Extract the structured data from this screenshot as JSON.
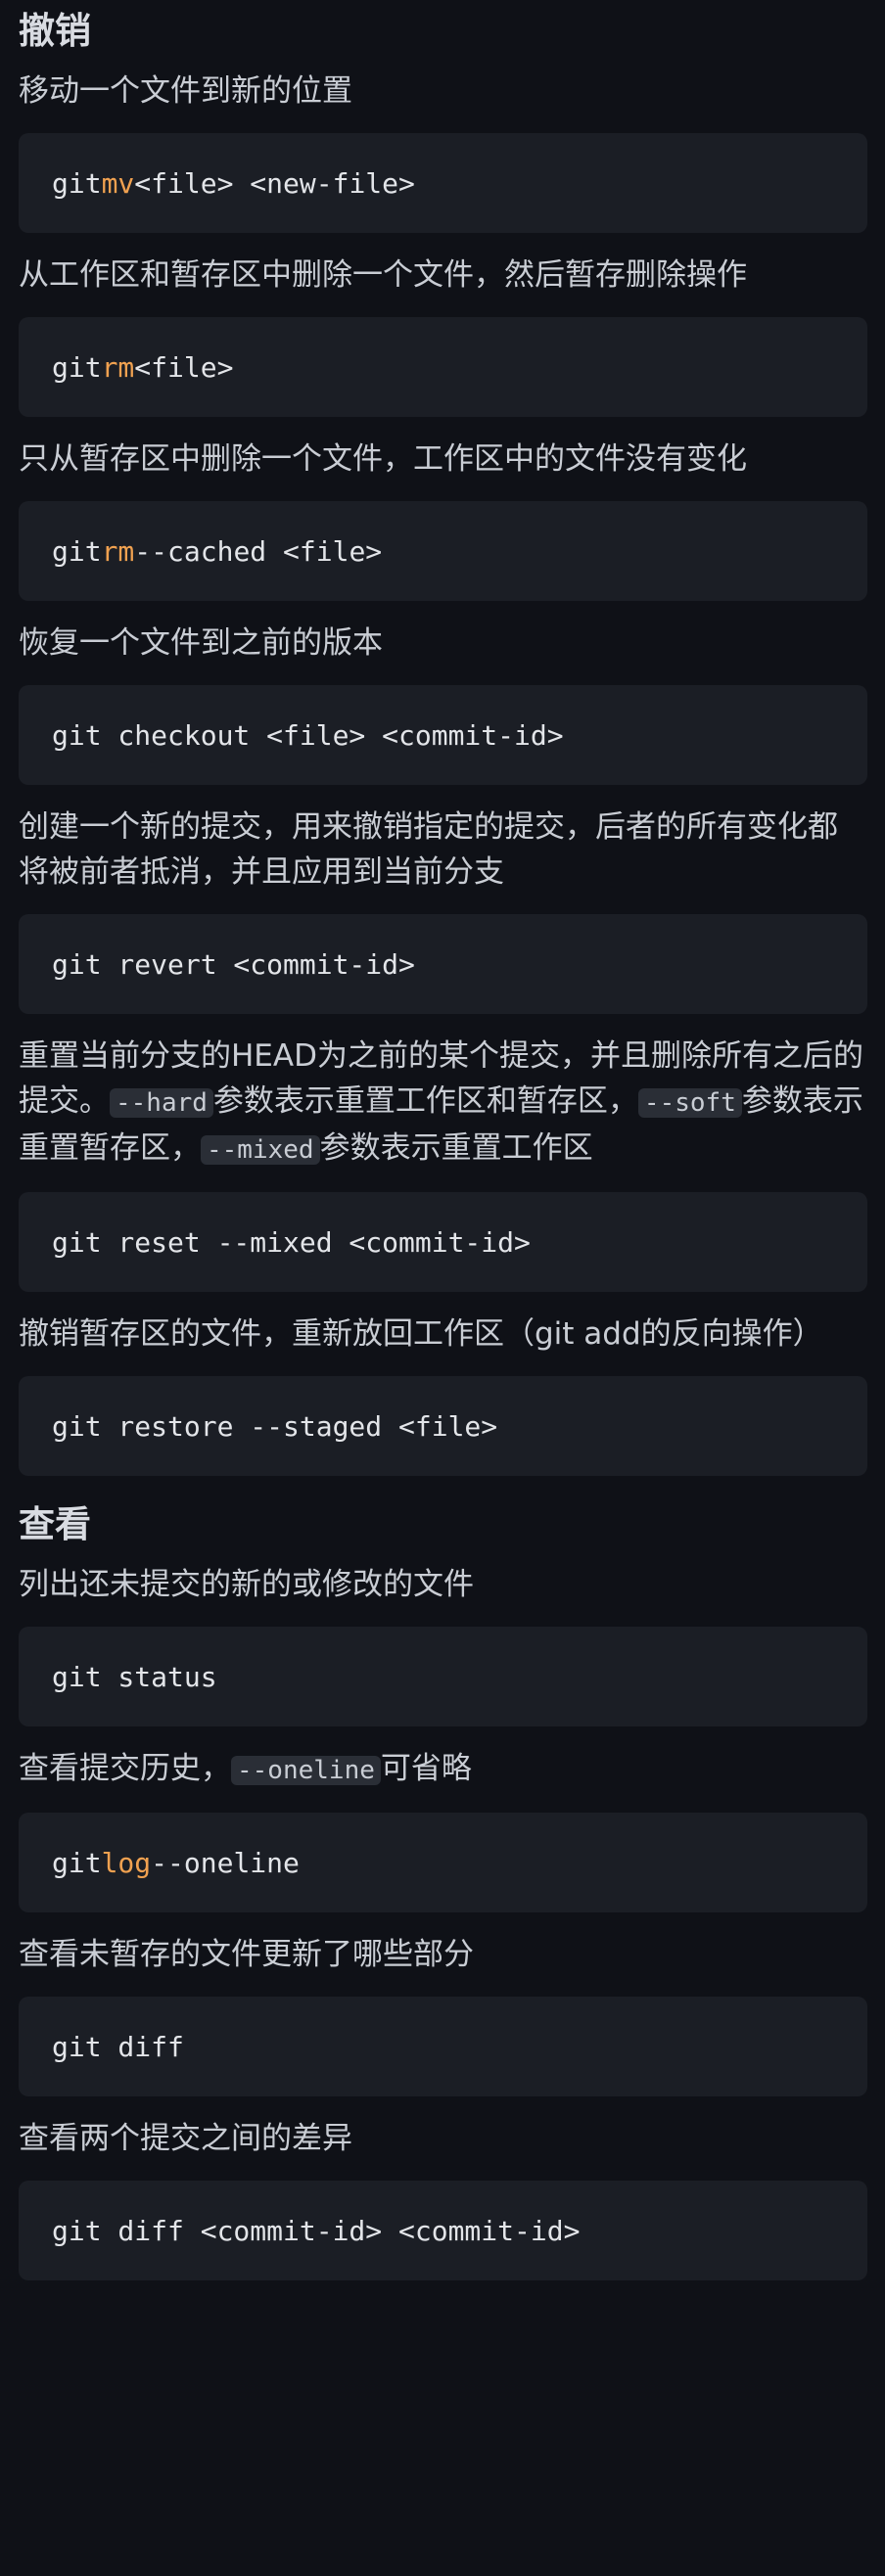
{
  "sections": [
    {
      "title": "撤销",
      "items": [
        {
          "desc": "移动一个文件到新的位置",
          "cmd": "git",
          "kw": "mv",
          "args": "<file> <new-file>"
        },
        {
          "desc": "从工作区和暂存区中删除一个文件，然后暂存删除操作",
          "cmd": "git",
          "kw": "rm",
          "args": "<file>"
        },
        {
          "desc": "只从暂存区中删除一个文件，工作区中的文件没有变化",
          "cmd": "git",
          "kw": "rm",
          "args": "--cached <file>"
        },
        {
          "desc": "恢复一个文件到之前的版本",
          "cmd": "git checkout <file> <commit-id>"
        },
        {
          "desc": "创建一个新的提交，用来撤销指定的提交，后者的所有变化都将被前者抵消，并且应用到当前分支",
          "cmd": "git revert <commit-id>"
        },
        {
          "desc_parts": {
            "a": "重置当前分支的HEAD为之前的某个提交，并且删除所有之后的提交。",
            "code1": "--hard",
            "b": "参数表示重置工作区和暂存区，",
            "code2": "--soft",
            "c": "参数表示重置暂存区，",
            "code3": "--mixed",
            "d": "参数表示重置工作区"
          },
          "cmd": "git reset --mixed <commit-id>"
        },
        {
          "desc": "撤销暂存区的文件，重新放回工作区（git add的反向操作）",
          "cmd": "git restore --staged <file>"
        }
      ]
    },
    {
      "title": "查看",
      "items": [
        {
          "desc": "列出还未提交的新的或修改的文件",
          "cmd": "git status"
        },
        {
          "desc_parts": {
            "code1": "--oneline",
            "a": "查看提交历史，",
            "b": "可省略"
          },
          "cmd": "git",
          "kw": "log",
          "args": "--oneline"
        },
        {
          "desc": "查看未暂存的文件更新了哪些部分",
          "cmd": "git diff"
        },
        {
          "desc": "查看两个提交之间的差异",
          "cmd": "git diff <commit-id> <commit-id>"
        }
      ]
    }
  ]
}
